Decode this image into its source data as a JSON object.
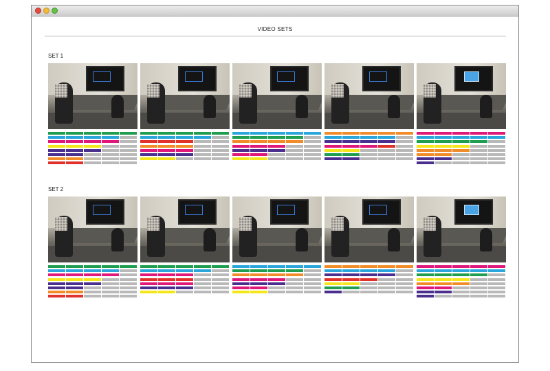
{
  "window": {
    "title": ""
  },
  "page": {
    "title": "VIDEO SETS"
  },
  "colors": {
    "G": "#1f9e4f",
    "C": "#2aa6dc",
    "M": "#e0187a",
    "Y": "#f5e61b",
    "P": "#4a2f8f",
    "O": "#f28c28",
    "R": "#e0322a",
    "g": "#b9b9b9"
  },
  "sets": [
    {
      "label": "SET 1",
      "clips": [
        {
          "thumbnail": "video-frame-tv-off",
          "rows": [
            "GGGGG",
            "CCCCg",
            "MMMMg",
            "YYYgg",
            "PPPgg",
            "PPggg",
            "OOggg",
            "RRggg"
          ]
        },
        {
          "thumbnail": "video-frame-tv-off",
          "rows": [
            "GGGGG",
            "CCCCg",
            "RRRgg",
            "OOOgg",
            "MMMgg",
            "PPPgg",
            "YYggg"
          ]
        },
        {
          "thumbnail": "video-frame-tv-off",
          "rows": [
            "CCCCC",
            "GGGGg",
            "OOOOg",
            "MMMgg",
            "PPPgg",
            "MMggg",
            "YYggg"
          ]
        },
        {
          "thumbnail": "video-frame-tv-off",
          "rows": [
            "OOOOO",
            "CCCCg",
            "PPPPg",
            "MMMRg",
            "YYggg",
            "GGggg",
            "PPggg"
          ]
        },
        {
          "thumbnail": "video-frame-tv-on",
          "rows": [
            "MMMMM",
            "CCCCC",
            "GGGGg",
            "YYYgg",
            "OOOgg",
            "OOggg",
            "PPggg",
            "Pgggg"
          ]
        }
      ]
    },
    {
      "label": "SET 2",
      "clips": [
        {
          "thumbnail": "video-frame-tv-off",
          "rows": [
            "GGGGG",
            "CCCCg",
            "MMMMg",
            "YYYgg",
            "PPPgg",
            "PPggg",
            "OOggg",
            "RRggg"
          ]
        },
        {
          "thumbnail": "video-frame-tv-off",
          "rows": [
            "GGGGG",
            "CCCCg",
            "MMMgg",
            "RRRgg",
            "MMMgg",
            "PPPgg",
            "YYggg"
          ]
        },
        {
          "thumbnail": "video-frame-tv-off",
          "rows": [
            "CCCCC",
            "GGGGg",
            "OOOOg",
            "MMMgg",
            "PPPgg",
            "MMggg",
            "YYggg"
          ]
        },
        {
          "thumbnail": "video-frame-tv-off",
          "rows": [
            "OOOOO",
            "CCCCg",
            "PPPPg",
            "RRRgg",
            "YYggg",
            "GGggg",
            "Pgggg"
          ]
        },
        {
          "thumbnail": "video-frame-tv-on",
          "rows": [
            "MMMMM",
            "CCCCC",
            "GGGGg",
            "YYYgg",
            "OOOgg",
            "MMggg",
            "PPggg",
            "Pgggg"
          ]
        }
      ]
    }
  ]
}
